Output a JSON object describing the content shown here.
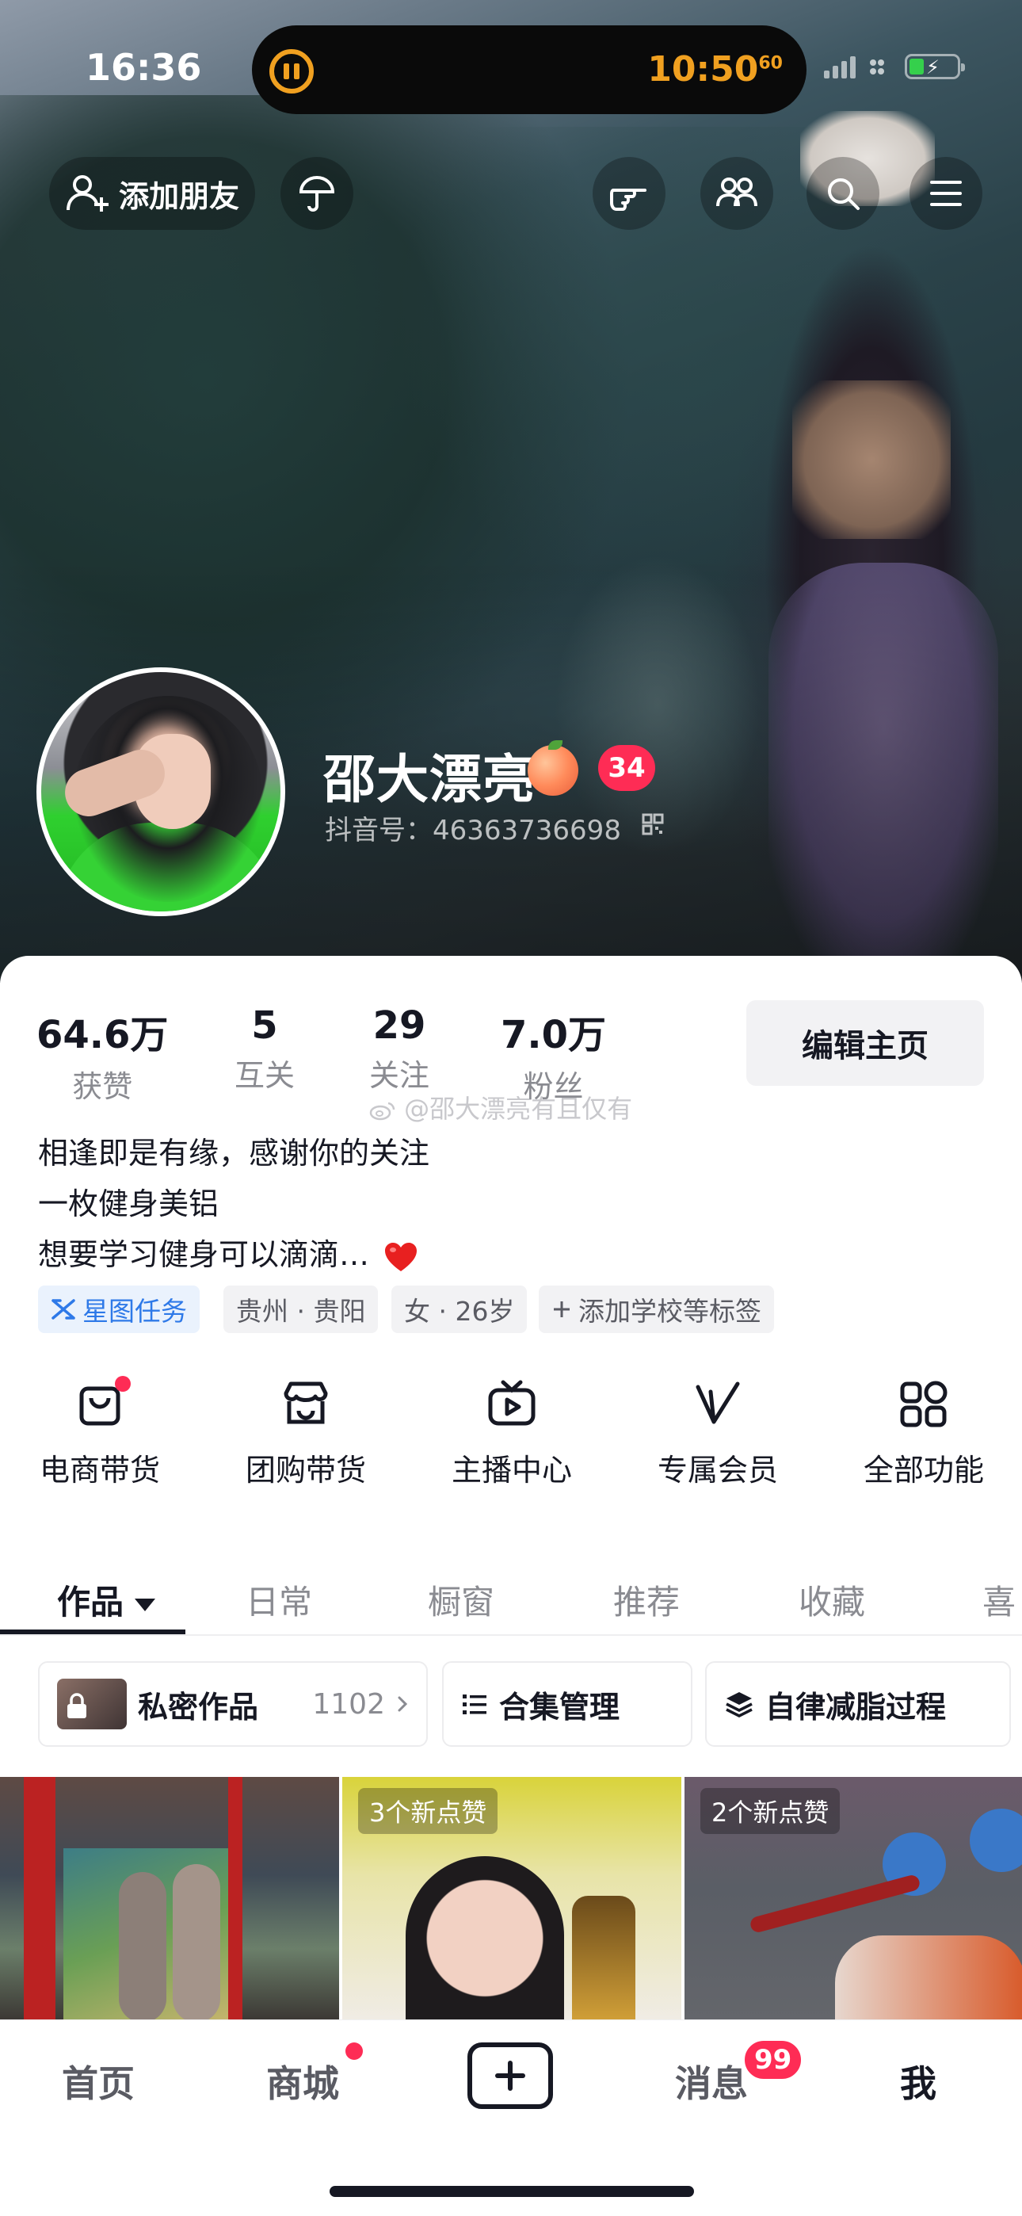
{
  "status_bar": {
    "time": "16:36",
    "island_timer": "10:50",
    "island_timer_seconds": "60"
  },
  "header": {
    "add_friend_label": "添加朋友"
  },
  "profile": {
    "name": "邵大漂亮",
    "level": "34",
    "douyin_id": "抖音号：46363736698"
  },
  "stats": [
    {
      "value": "64.6万",
      "label": "获赞"
    },
    {
      "value": "5",
      "label": "互关"
    },
    {
      "value": "29",
      "label": "关注"
    },
    {
      "value": "7.0万",
      "label": "粉丝"
    }
  ],
  "edit_profile_label": "编辑主页",
  "watermark": "@邵大漂亮有且仅有",
  "bio": [
    "相逢即是有缘，感谢你的关注",
    "一枚健身美铝",
    "想要学习健身可以滴滴…"
  ],
  "tags": {
    "xingtu": "星图任务",
    "location": "贵州 · 贵阳",
    "gender_age": "女 · 26岁",
    "school": "添加学校等标签"
  },
  "functions": [
    {
      "label": "电商带货",
      "icon": "shopping-bag-icon"
    },
    {
      "label": "团购带货",
      "icon": "store-icon"
    },
    {
      "label": "主播中心",
      "icon": "tv-play-icon"
    },
    {
      "label": "专属会员",
      "icon": "v-member-icon"
    },
    {
      "label": "全部功能",
      "icon": "grid-icon"
    }
  ],
  "tabs": [
    "作品",
    "日常",
    "橱窗",
    "推荐",
    "收藏",
    "喜"
  ],
  "chips": {
    "private_label": "私密作品",
    "private_count": "1102",
    "collection_label": "合集管理",
    "fatloss_label": "自律减脂过程"
  },
  "videos": [
    {
      "overlay": ""
    },
    {
      "overlay": "3个新点赞"
    },
    {
      "overlay": "2个新点赞"
    }
  ],
  "bottom_nav": {
    "home": "首页",
    "mall": "商城",
    "inbox": "消息",
    "inbox_badge": "99",
    "me": "我"
  },
  "colors": {
    "accent_red": "#fe2c55",
    "text_primary": "#161823",
    "text_secondary": "#8a8b91",
    "xingtu_blue": "#2e79e8",
    "timer_orange": "#f0a020"
  }
}
